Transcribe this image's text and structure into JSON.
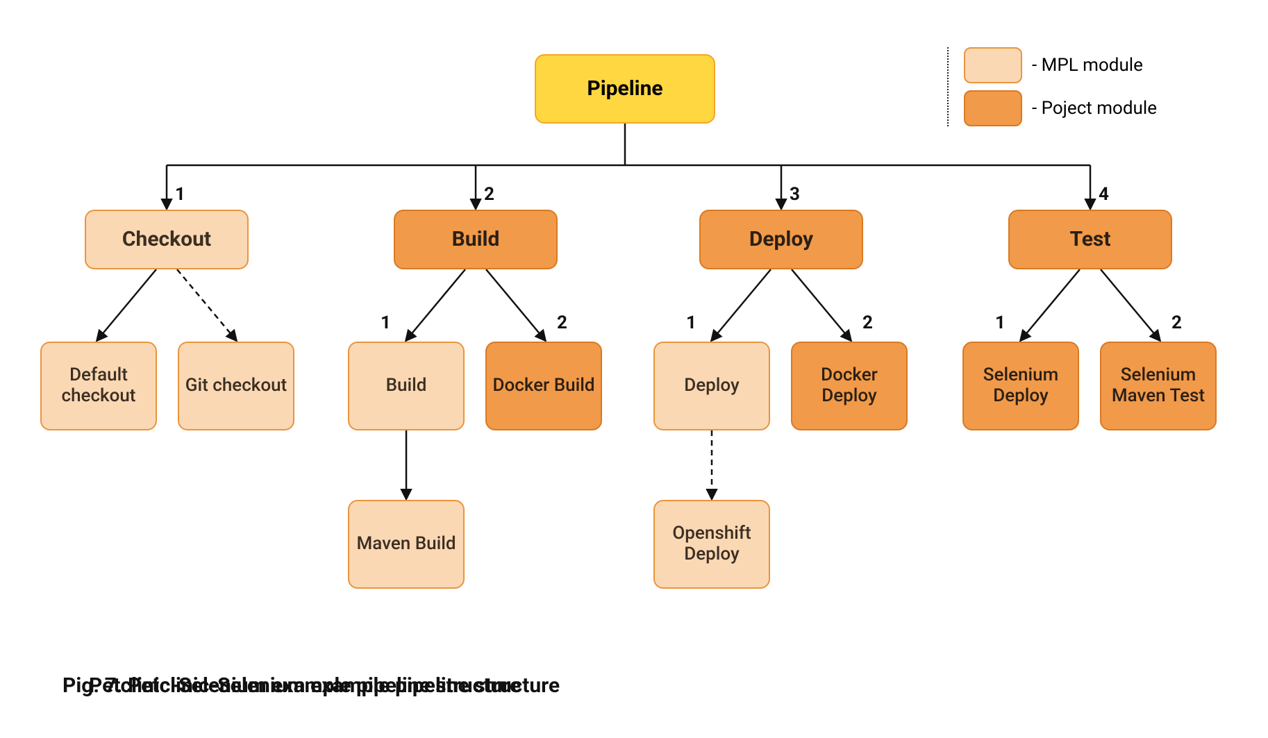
{
  "colors": {
    "pipeline_fill": "#ffd740",
    "pipeline_border": "#f5a623",
    "mpl_fill": "#fbd8b4",
    "mpl_border": "#e8953e",
    "project_fill": "#f19a4a",
    "project_border": "#d97a22"
  },
  "root": {
    "label": "Pipeline"
  },
  "stages": {
    "checkout": {
      "label": "Checkout",
      "order": "1",
      "children": {
        "default_checkout": {
          "label": "Default checkout"
        },
        "git_checkout": {
          "label": "Git checkout"
        }
      }
    },
    "build": {
      "label": "Build",
      "order": "2",
      "children": {
        "build": {
          "label": "Build",
          "order": "1"
        },
        "docker_build": {
          "label": "Docker Build",
          "order": "2"
        },
        "maven_build": {
          "label": "Maven Build"
        }
      }
    },
    "deploy": {
      "label": "Deploy",
      "order": "3",
      "children": {
        "deploy": {
          "label": "Deploy",
          "order": "1"
        },
        "docker_deploy": {
          "label": "Docker Deploy",
          "order": "2"
        },
        "openshift_deploy": {
          "label": "Openshift Deploy"
        }
      }
    },
    "test": {
      "label": "Test",
      "order": "4",
      "children": {
        "selenium_deploy": {
          "label": "Selenium Deploy",
          "order": "1"
        },
        "selenium_maven_test": {
          "label": "Selenium Maven Test",
          "order": "2"
        }
      }
    }
  },
  "legend": {
    "mpl": "- MPL module",
    "project": "- Poject module"
  },
  "caption_a": "Pig. 7. Petclinic-Selenium example pipeline structure",
  "caption_b": "Petclinic-Selenium example pipeline structure"
}
